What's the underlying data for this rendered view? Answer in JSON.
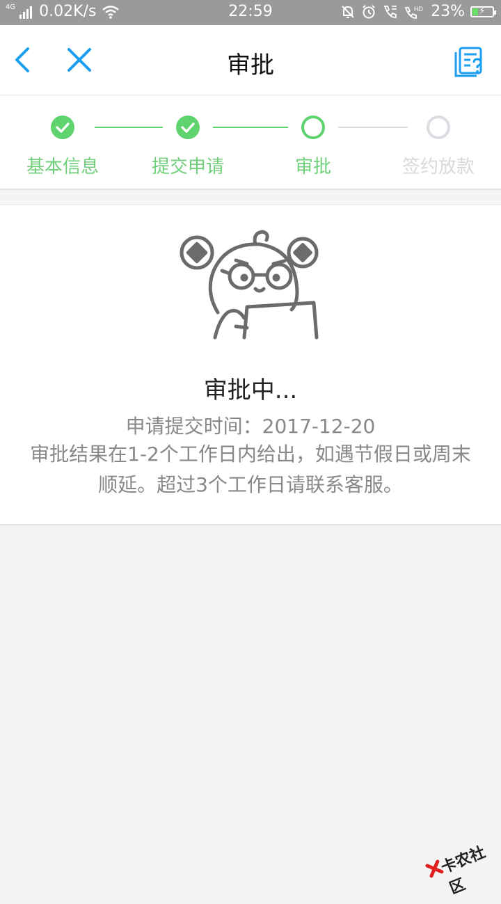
{
  "status_bar": {
    "network": "4G",
    "speed": "0.02K/s",
    "time": "22:59",
    "battery_percent": "23%",
    "icons": [
      "signal-icon",
      "wifi-icon",
      "mute-icon",
      "alarm-icon",
      "call-icon",
      "hd-call-icon",
      "battery-icon"
    ]
  },
  "header": {
    "title": "审批",
    "back_icon": "back-icon",
    "close_icon": "close-icon",
    "help_icon": "document-help-icon",
    "accent_color": "#1a9ef0"
  },
  "steps": [
    {
      "label": "基本信息",
      "state": "done"
    },
    {
      "label": "提交申请",
      "state": "done"
    },
    {
      "label": "审批",
      "state": "active"
    },
    {
      "label": "签约放款",
      "state": "todo"
    }
  ],
  "colors": {
    "step_done": "#5fd36d",
    "step_label_active": "#6fcf7a",
    "step_todo": "#dcdce2"
  },
  "approval": {
    "illustration": "reviewer-character-illustration",
    "title": "审批中...",
    "submit_time": "申请提交时间：2017-12-20",
    "description": "审批结果在1-2个工作日内给出，如遇节假日或周末顺延。超过3个工作日请联系客服。"
  },
  "watermark": {
    "text": "卡农社区"
  }
}
